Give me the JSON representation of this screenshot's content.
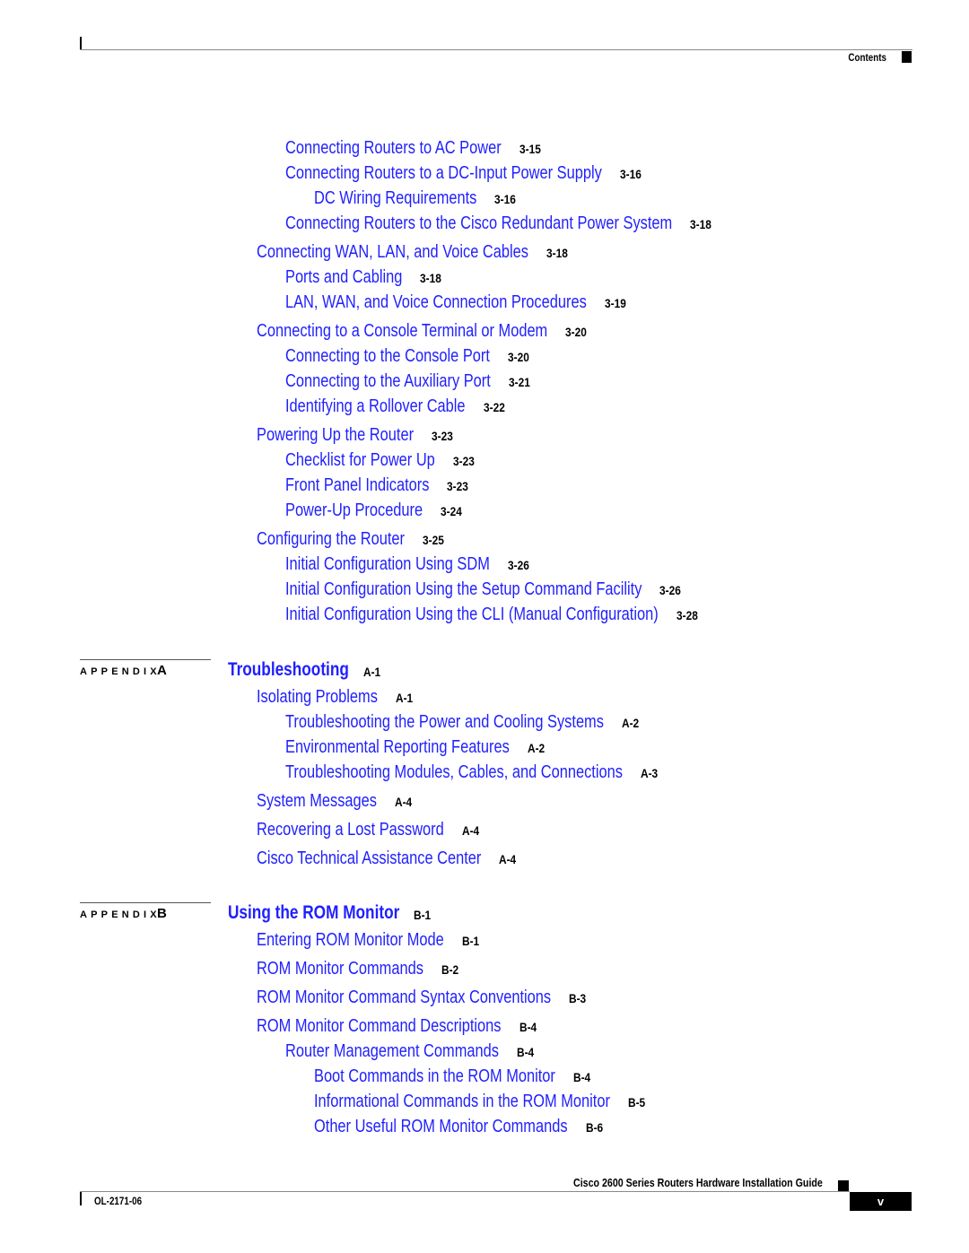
{
  "header": {
    "section_label": "Contents"
  },
  "toc": {
    "chapter3_entries": [
      {
        "title": "Connecting Routers to AC Power",
        "page": "3-15",
        "level": 2
      },
      {
        "title": "Connecting Routers to a DC-Input Power Supply",
        "page": "3-16",
        "level": 2
      },
      {
        "title": "DC Wiring Requirements",
        "page": "3-16",
        "level": 3
      },
      {
        "title": "Connecting Routers to the Cisco Redundant Power System",
        "page": "3-18",
        "level": 2
      },
      {
        "title": "Connecting WAN, LAN, and Voice Cables",
        "page": "3-18",
        "level": 1
      },
      {
        "title": "Ports and Cabling",
        "page": "3-18",
        "level": 2
      },
      {
        "title": "LAN, WAN, and Voice Connection Procedures",
        "page": "3-19",
        "level": 2
      },
      {
        "title": "Connecting to a Console Terminal or Modem",
        "page": "3-20",
        "level": 1
      },
      {
        "title": "Connecting to the Console Port",
        "page": "3-20",
        "level": 2
      },
      {
        "title": "Connecting to the Auxiliary Port",
        "page": "3-21",
        "level": 2
      },
      {
        "title": "Identifying a Rollover Cable",
        "page": "3-22",
        "level": 2
      },
      {
        "title": "Powering Up the Router",
        "page": "3-23",
        "level": 1
      },
      {
        "title": "Checklist for Power Up",
        "page": "3-23",
        "level": 2
      },
      {
        "title": "Front Panel Indicators",
        "page": "3-23",
        "level": 2
      },
      {
        "title": "Power-Up Procedure",
        "page": "3-24",
        "level": 2
      },
      {
        "title": "Configuring the Router",
        "page": "3-25",
        "level": 1
      },
      {
        "title": "Initial Configuration Using SDM",
        "page": "3-26",
        "level": 2
      },
      {
        "title": "Initial Configuration Using the Setup Command Facility",
        "page": "3-26",
        "level": 2
      },
      {
        "title": "Initial Configuration Using the CLI (Manual Configuration)",
        "page": "3-28",
        "level": 2
      }
    ],
    "appendices": [
      {
        "label": "APPENDIX",
        "letter": "A",
        "title": "Troubleshooting",
        "page": "A-1",
        "entries": [
          {
            "title": "Isolating Problems",
            "page": "A-1",
            "level": 1
          },
          {
            "title": "Troubleshooting the Power and Cooling Systems",
            "page": "A-2",
            "level": 2
          },
          {
            "title": "Environmental Reporting Features",
            "page": "A-2",
            "level": 2
          },
          {
            "title": "Troubleshooting Modules, Cables, and Connections",
            "page": "A-3",
            "level": 2
          },
          {
            "title": "System Messages",
            "page": "A-4",
            "level": 1
          },
          {
            "title": "Recovering a Lost Password",
            "page": "A-4",
            "level": 1
          },
          {
            "title": "Cisco Technical Assistance Center",
            "page": "A-4",
            "level": 1
          }
        ]
      },
      {
        "label": "APPENDIX",
        "letter": "B",
        "title": "Using the ROM Monitor",
        "page": "B-1",
        "entries": [
          {
            "title": "Entering ROM Monitor Mode",
            "page": "B-1",
            "level": 1
          },
          {
            "title": "ROM Monitor Commands",
            "page": "B-2",
            "level": 1
          },
          {
            "title": "ROM Monitor Command Syntax Conventions",
            "page": "B-3",
            "level": 1
          },
          {
            "title": "ROM Monitor Command Descriptions",
            "page": "B-4",
            "level": 1
          },
          {
            "title": "Router Management Commands",
            "page": "B-4",
            "level": 2
          },
          {
            "title": "Boot Commands in the ROM Monitor",
            "page": "B-4",
            "level": 3
          },
          {
            "title": "Informational Commands in the ROM Monitor",
            "page": "B-5",
            "level": 3
          },
          {
            "title": "Other Useful ROM Monitor Commands",
            "page": "B-6",
            "level": 3
          }
        ]
      }
    ]
  },
  "footer": {
    "guide_title": "Cisco 2600 Series Routers Hardware Installation Guide",
    "doc_number": "OL-2171-06",
    "page_number": "v"
  }
}
